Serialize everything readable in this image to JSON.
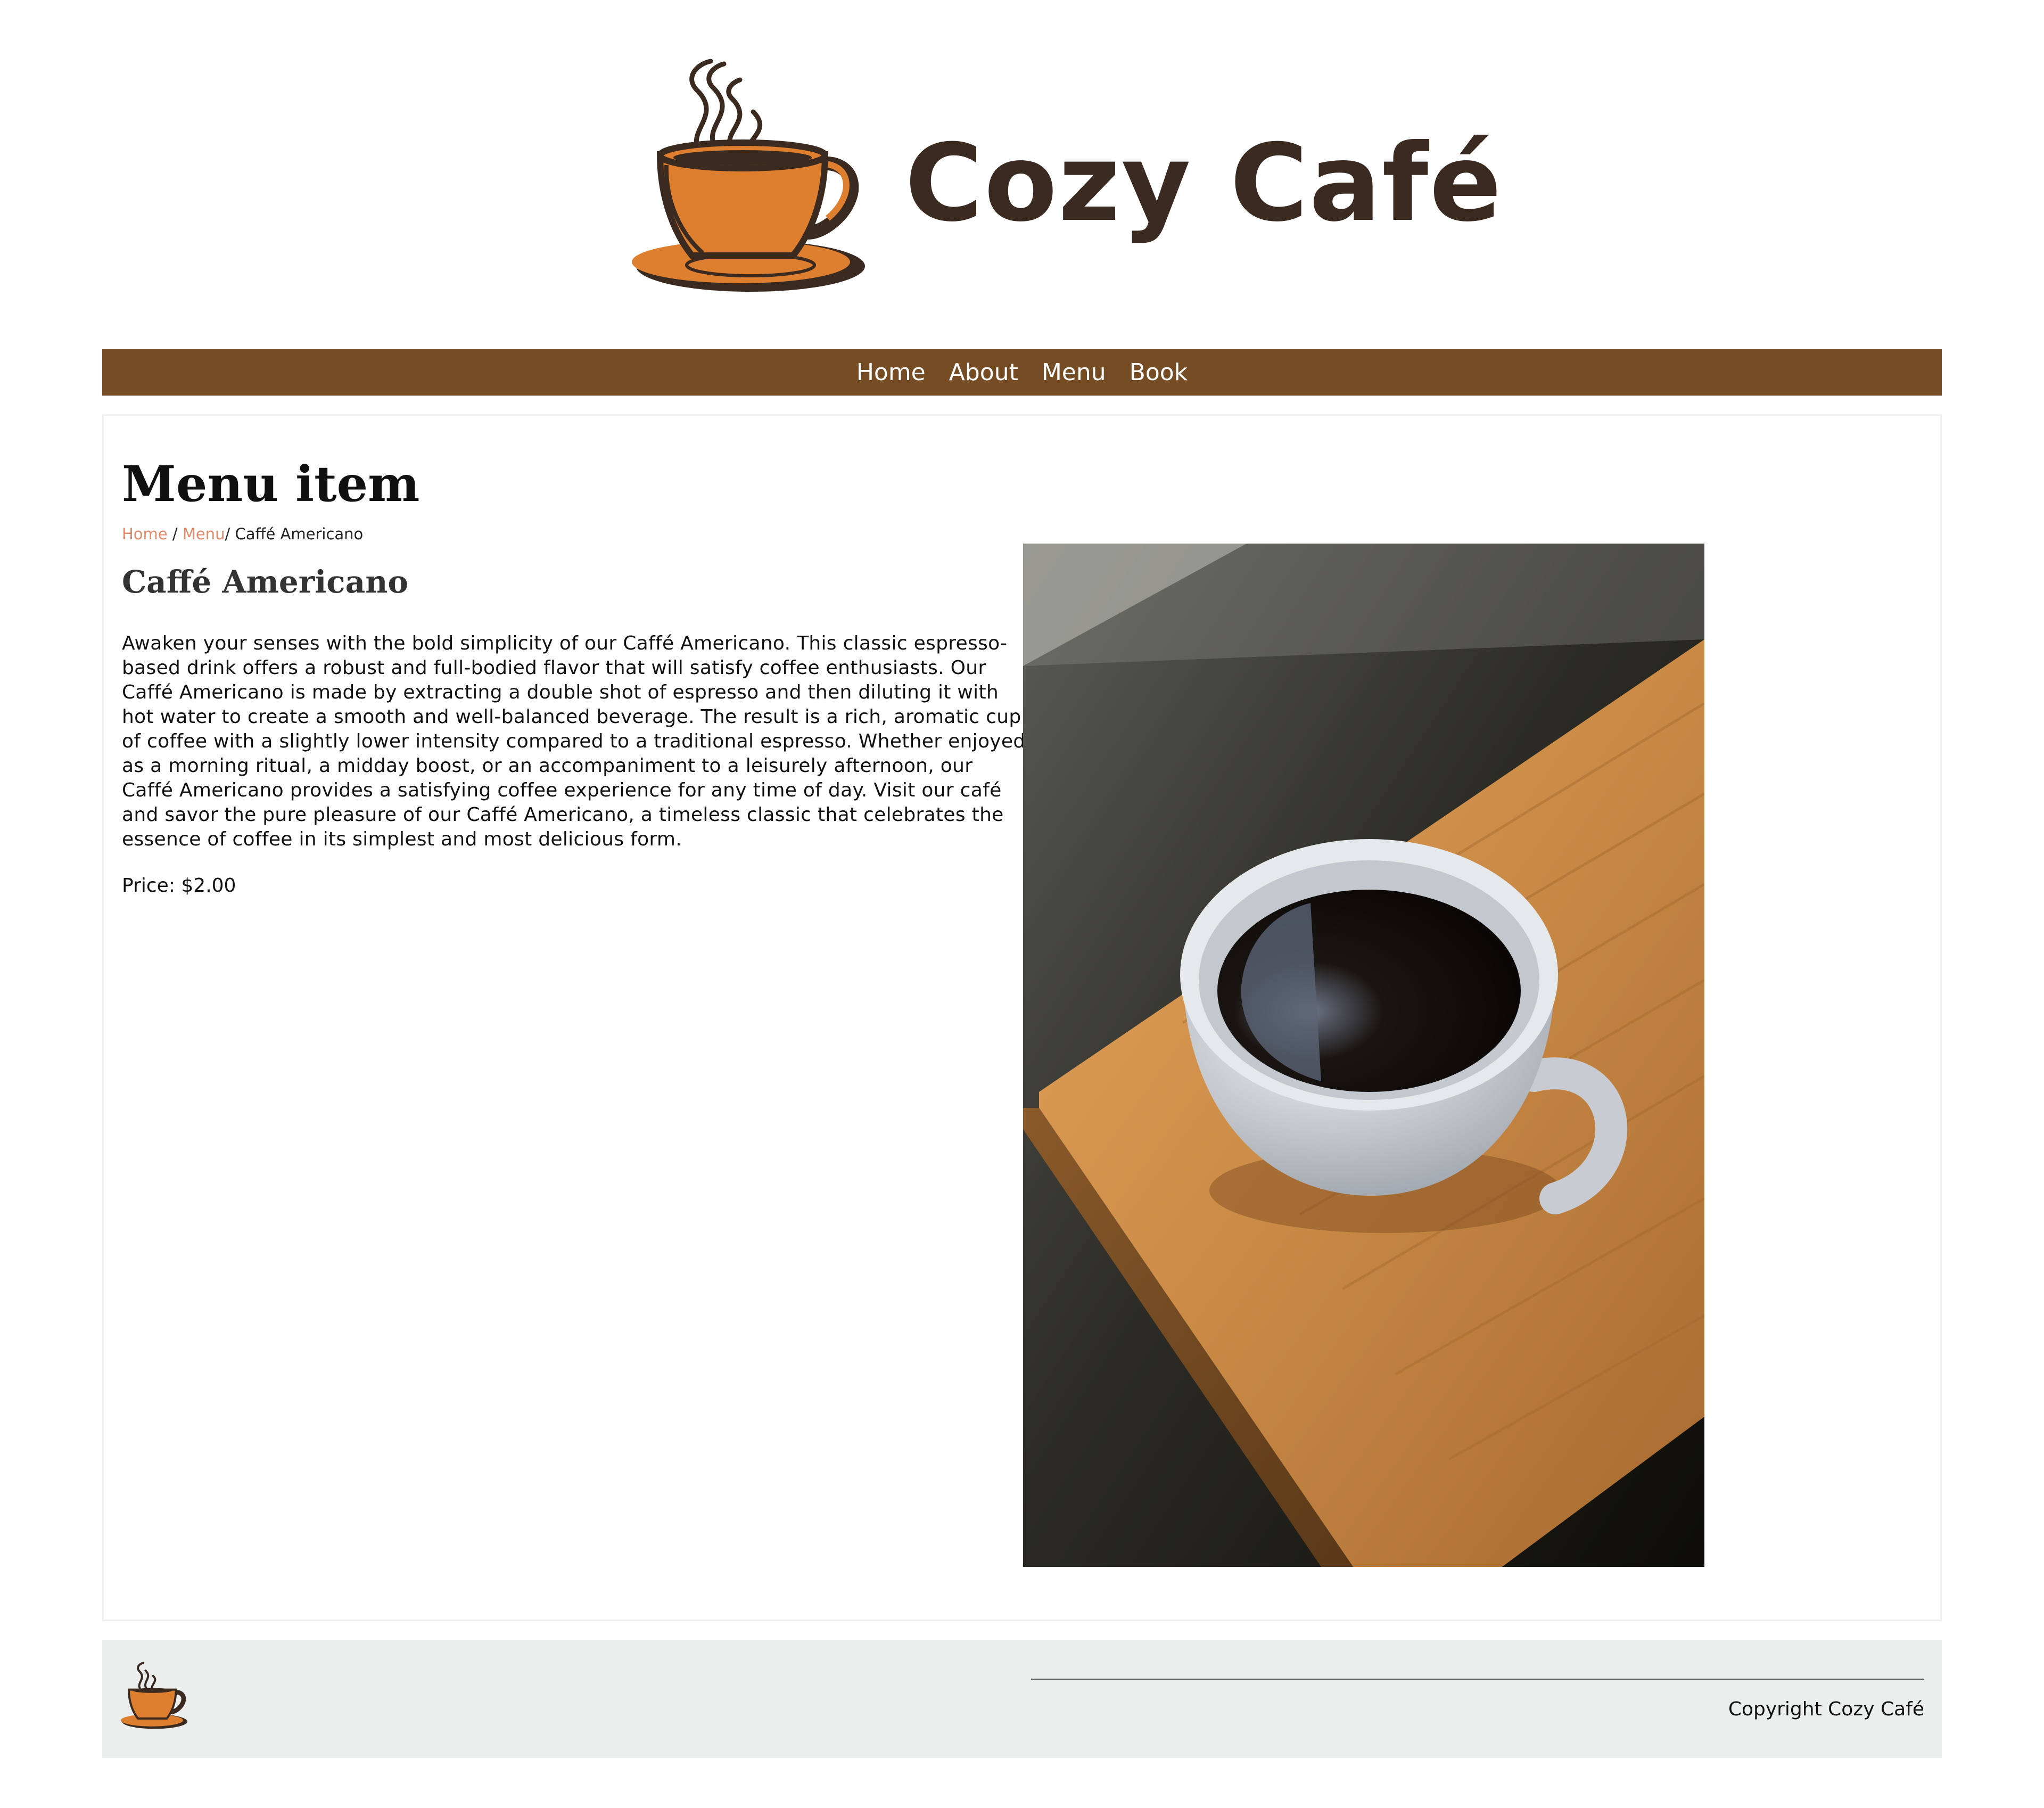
{
  "brand": {
    "name": "Cozy Café",
    "logo_icon": "coffee-cup-logo-icon"
  },
  "nav": {
    "items": [
      {
        "label": "Home"
      },
      {
        "label": "About"
      },
      {
        "label": "Menu"
      },
      {
        "label": "Book"
      }
    ]
  },
  "page": {
    "title": "Menu item",
    "breadcrumb": {
      "home": "Home",
      "separator1": " / ",
      "menu": "Menu",
      "separator2": "/ ",
      "current": "Caffé Americano"
    },
    "item": {
      "name": "Caffé Americano",
      "description": "Awaken your senses with the bold simplicity of our Caffé Americano. This classic espresso-based drink offers a robust and full-bodied flavor that will satisfy coffee enthusiasts. Our Caffé Americano is made by extracting a double shot of espresso and then diluting it with hot water to create a smooth and well-balanced beverage. The result is a rich, aromatic cup of coffee with a slightly lower intensity compared to a traditional espresso. Whether enjoyed as a morning ritual, a midday boost, or an accompaniment to a leisurely afternoon, our Caffé Americano provides a satisfying coffee experience for any time of day. Visit our café and savor the pure pleasure of our Caffé Americano, a timeless classic that celebrates the essence of coffee in its simplest and most delicious form.",
      "price": "Price: $2.00",
      "photo": "coffee-cup-on-wooden-board-photo"
    }
  },
  "footer": {
    "copyright": "Copyright Cozy Café",
    "logo_icon": "coffee-cup-logo-icon"
  },
  "colors": {
    "nav_bg": "#754c24",
    "logo_cup": "#dd7f2f",
    "logo_text": "#3a2a20",
    "breadcrumb_link": "#e08a6a",
    "footer_bg": "#eceeee"
  }
}
